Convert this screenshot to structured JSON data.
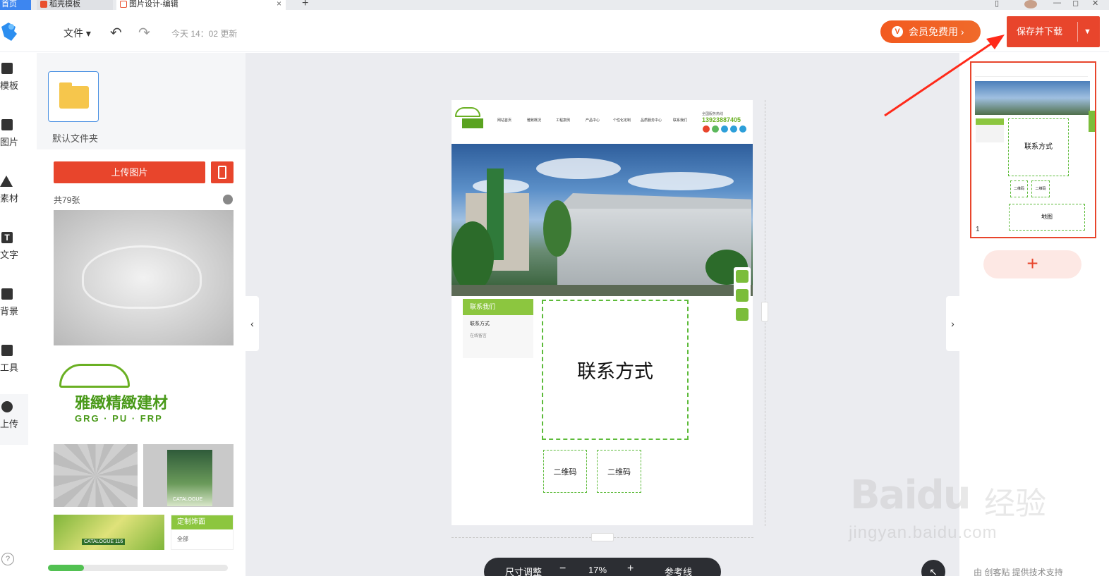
{
  "browser": {
    "tabs": [
      {
        "label": "首页"
      },
      {
        "label": "稻壳模板"
      },
      {
        "label": "图片设计-编辑"
      }
    ],
    "new_tab": "+",
    "close": "×"
  },
  "header": {
    "file_menu": "文件",
    "update_status": "今天 14：02 更新",
    "vip_button": "会员免费用",
    "save_button": "保存并下载"
  },
  "rail": {
    "items": [
      {
        "label": "模板",
        "icon": "template-icon"
      },
      {
        "label": "图片",
        "icon": "image-icon"
      },
      {
        "label": "素材",
        "icon": "shapes-icon"
      },
      {
        "label": "文字",
        "icon": "text-icon"
      },
      {
        "label": "背景",
        "icon": "background-icon"
      },
      {
        "label": "工具",
        "icon": "toolbox-icon"
      },
      {
        "label": "上传",
        "icon": "cloud-upload-icon"
      }
    ],
    "help": "?"
  },
  "panel": {
    "folder_label": "默认文件夹",
    "upload_button": "上传图片",
    "count": "共79张",
    "thumb_logo_main": "雅緻精緻建材",
    "thumb_logo_sub": "GRG · PU · FRP",
    "thumb_book": "CATALOGUE",
    "thumb_catalogue": "CATALOGUE 116",
    "thumb_custom_title": "定制饰面",
    "thumb_custom_item": "全部",
    "upload_progress": 0.2
  },
  "design": {
    "phone_label": "全国服务热线",
    "phone": "13923887405",
    "nav": [
      "网站首页",
      "雅致概况",
      "工程案例",
      "产品中心",
      "个性化定制",
      "品质服务中心",
      "联系我们"
    ],
    "side_menu_title": "联系我们",
    "side_menu_item1": "联系方式",
    "side_menu_item2": "在线留言",
    "main_placeholder": "联系方式",
    "qr1": "二维码",
    "qr2": "二维码"
  },
  "zoom": {
    "size_label": "尺寸调整",
    "minus": "−",
    "value": "17%",
    "plus": "+",
    "guides_label": "参考线"
  },
  "thumbnails": {
    "page_number": "1",
    "mini_main": "联系方式",
    "mini_qr1": "二维码",
    "mini_qr2": "二维码",
    "mini_map": "地图",
    "add_page": "+"
  },
  "footer": {
    "support": "由 创客贴 提供技术支持"
  },
  "watermark": {
    "brand": "Bai",
    "brand2": "du",
    "label": "经验",
    "url": "jingyan.baidu.com"
  },
  "colors": {
    "accent": "#e8452c",
    "green": "#8cc63f",
    "dashed": "#5dbb3a"
  }
}
